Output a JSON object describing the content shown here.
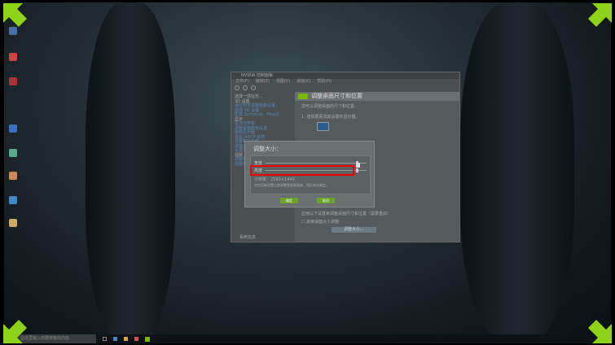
{
  "window": {
    "title": "NVIDIA 控制面板",
    "menu": [
      "文件(F)",
      "编辑(E)",
      "视图(V)",
      "桌面(K)",
      "帮助(H)"
    ],
    "sidebar": [
      "选择一项任务...",
      "3D 设置",
      "通过预览调整图像设置",
      "管理 3D 设置",
      "配置 Surround、PhysX",
      "显示",
      "更改分辨率",
      "调整桌面颜色设置",
      "旋转显示器",
      "查看 HDCP 状态",
      "设置数字音频",
      "调整桌面尺寸和位置",
      "设置多个显示器",
      "视频",
      "调整视频颜色设置",
      "调整视频图像设置"
    ],
    "system_info": "系统信息",
    "main_title": "调整桌面尺寸和位置",
    "main_desc": "您可以调整桌面的尺寸和位置。",
    "step1": "1. 选择要更改其设置的显示器。",
    "step_apply": "应用以下设置来调整桌面尺寸和位置（需要重启）",
    "checkbox": "启用桌面大小调整",
    "resize_button": "调整大小..."
  },
  "dialog": {
    "title": "调整大小：",
    "width_label": "宽度",
    "height_label": "高度",
    "resolution": "分辨率：2560×1440",
    "note": "在应用新设置之前调整宽度和高度，然后单击确定。",
    "ok": "确定",
    "cancel": "取消"
  },
  "taskbar": {
    "search_placeholder": "在这里输入你要搜索的内容"
  },
  "colors": {
    "accent": "#76b900",
    "highlight": "#e00000"
  }
}
